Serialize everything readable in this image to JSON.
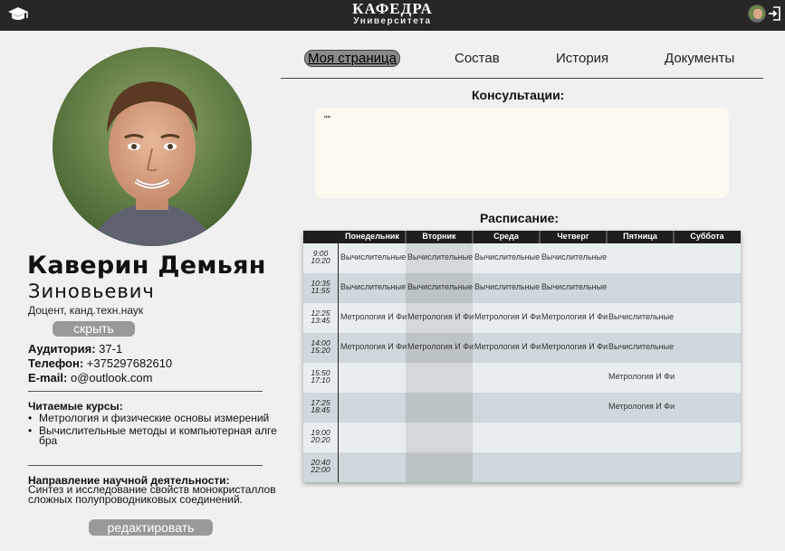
{
  "header": {
    "title": "КАФЕДРА",
    "subtitle": "Университета",
    "icons": [
      "graduation-cap-icon",
      "user-avatar",
      "logout-icon"
    ]
  },
  "profile": {
    "surname_name": "Каверин Демьян",
    "patronymic": "Зиновьевич",
    "degree": "Доцент, канд.техн.наук",
    "hide_label": "скрыть",
    "room_label": "Аудитория:",
    "room_value": "37-1",
    "phone_label": "Телефон:",
    "phone_value": "+375297682610",
    "email_label": "E-mail:",
    "email_value": "o@outlook.com",
    "courses_title": "Читаемые курсы:",
    "courses": [
      "Метрология и физические основы измерений",
      "Вычислительные методы и компьютерная алгебра"
    ],
    "research_title": "Направление научной деятельности:",
    "research_text": "Синтез и исследование свойств монокристаллов сложных полупроводниковых соединений.",
    "edit_label": "редактировать"
  },
  "tabs": [
    {
      "label": "Моя страница",
      "active": true
    },
    {
      "label": "Состав",
      "active": false
    },
    {
      "label": "История",
      "active": false
    },
    {
      "label": "Документы",
      "active": false
    }
  ],
  "consultations": {
    "title": "Консультации:",
    "content": "\"\""
  },
  "schedule": {
    "title": "Расписание:",
    "days": [
      "Понедельник",
      "Вторник",
      "Среда",
      "Четверг",
      "Пятница",
      "Суббота"
    ],
    "rows": [
      {
        "start": "9:00",
        "end": "10:20",
        "cells": [
          "Вычислительные",
          "Вычислительные",
          "Вычислительные",
          "Вычислительные",
          "",
          ""
        ]
      },
      {
        "start": "10:35",
        "end": "11:55",
        "cells": [
          "Вычислительные",
          "Вычислительные",
          "Вычислительные",
          "Вычислительные",
          "",
          ""
        ]
      },
      {
        "start": "12:25",
        "end": "13:45",
        "cells": [
          "Метрология И Фи:",
          "Метрология И Фи:",
          "Метрология И Фи:",
          "Метрология И Фи:",
          "Вычислительные",
          ""
        ]
      },
      {
        "start": "14:00",
        "end": "15:20",
        "cells": [
          "Метрология И Фи:",
          "Метрология И Фи:",
          "Метрология И Фи:",
          "Метрология И Фи:",
          "Вычислительные",
          ""
        ]
      },
      {
        "start": "15:50",
        "end": "17:10",
        "cells": [
          "",
          "",
          "",
          "",
          "Метрология И Фи:",
          ""
        ]
      },
      {
        "start": "17:25",
        "end": "18:45",
        "cells": [
          "",
          "",
          "",
          "",
          "Метрология И Фи:",
          ""
        ]
      },
      {
        "start": "19:00",
        "end": "20:20",
        "cells": [
          "",
          "",
          "",
          "",
          "",
          ""
        ]
      },
      {
        "start": "20:40",
        "end": "22:00",
        "cells": [
          "",
          "",
          "",
          "",
          "",
          ""
        ]
      }
    ]
  },
  "colors": {
    "topbar": "#262626",
    "page_bg": "#f0f0f0",
    "button_bg": "#999999",
    "consult_bg": "#fdf8f0",
    "schedule_header": "#1e1e1e",
    "row_light": "#e8eef0",
    "row_dark": "#cfd8dc"
  }
}
